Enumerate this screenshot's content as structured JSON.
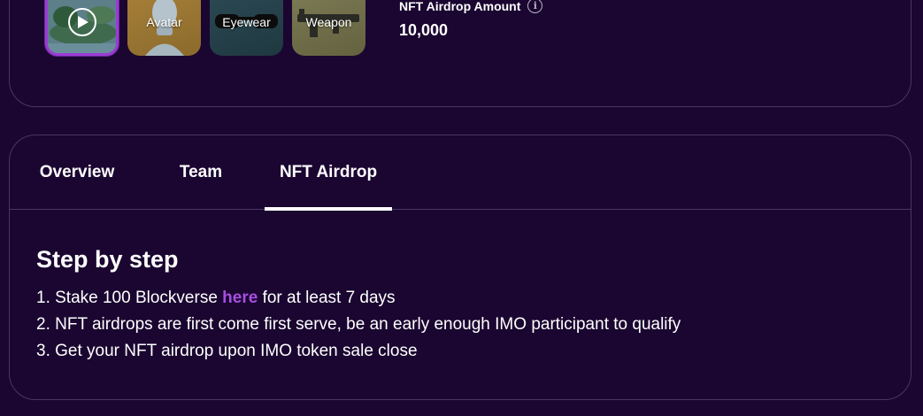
{
  "thumbnails": [
    {
      "kind": "video",
      "label": "",
      "icon": "play-icon",
      "selected": true
    },
    {
      "kind": "avatar",
      "label": "Avatar"
    },
    {
      "kind": "eyewear",
      "label": "Eyewear"
    },
    {
      "kind": "weapon",
      "label": "Weapon"
    }
  ],
  "airdrop": {
    "title": "NFT Airdrop Amount",
    "info_icon": "info-icon",
    "amount": "10,000"
  },
  "tabs": [
    {
      "label": "Overview",
      "active": false
    },
    {
      "label": "Team",
      "active": false
    },
    {
      "label": "NFT Airdrop",
      "active": true
    }
  ],
  "content": {
    "heading": "Step by step",
    "steps": [
      {
        "prefix": "1. Stake 100 Blockverse ",
        "link": "here",
        "suffix": " for at least 7 days"
      },
      {
        "text": "2. NFT airdrops are first come first serve, be an early enough IMO participant to qualify"
      },
      {
        "text": "3. Get your NFT airdrop upon IMO token sale close"
      }
    ]
  },
  "colors": {
    "background": "#1a0630",
    "border": "#4a3566",
    "accent": "#a64ee0",
    "selected_border": "#9b3bd6"
  }
}
